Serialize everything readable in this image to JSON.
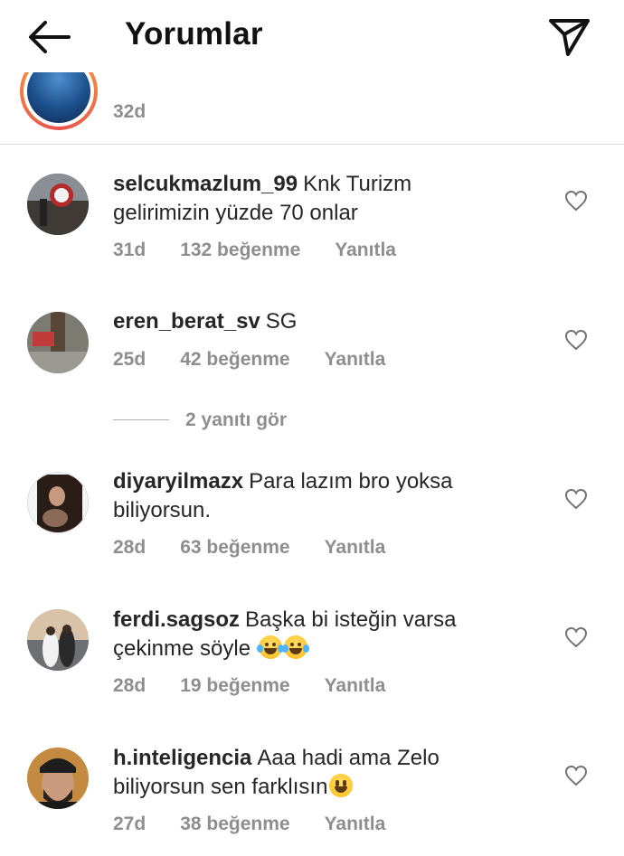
{
  "header": {
    "title": "Yorumlar",
    "back_icon": "arrow-left-icon",
    "send_icon": "send-icon"
  },
  "previous_comment": {
    "time": "32d"
  },
  "comments": [
    {
      "user": "selcukmazlum_99",
      "text": "Knk Turizm gelirimizin yüzde 70 onlar",
      "time": "31d",
      "likes": "132 beğenme",
      "reply": "Yanıtla"
    },
    {
      "user": "eren_berat_sv",
      "text": "SG",
      "time": "25d",
      "likes": "42 beğenme",
      "reply": "Yanıtla"
    },
    {
      "user": "diyaryilmazx",
      "text": "Para lazım bro yoksa biliyorsun.",
      "time": "28d",
      "likes": "63 beğenme",
      "reply": "Yanıtla"
    },
    {
      "user": "ferdi.sagsoz",
      "text": "Başka bi isteğin varsa çekinme söyle",
      "time": "28d",
      "likes": "19 beğenme",
      "reply": "Yanıtla"
    },
    {
      "user": "h.inteligencia",
      "text": "Aaa hadi ama Zelo biliyorsun sen farklısın",
      "time": "27d",
      "likes": "38 beğenme",
      "reply": "Yanıtla"
    }
  ],
  "view_replies": "2 yanıtı gör",
  "colors": {
    "text": "#262626",
    "muted": "#8e8e8e",
    "divider": "#dbdbdb",
    "story_ring": "#f9a33b"
  }
}
